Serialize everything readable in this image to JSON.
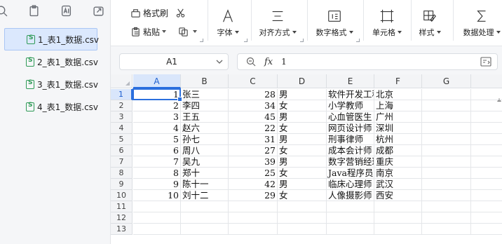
{
  "left_pane": {
    "files": [
      {
        "name": "1_表1_数据.csv",
        "selected": true
      },
      {
        "name": "2_表1_数据.csv",
        "selected": false
      },
      {
        "name": "3_表1_数据.csv",
        "selected": false
      },
      {
        "name": "4_表1_数据.csv",
        "selected": false
      }
    ]
  },
  "ribbon": {
    "format_painter": "格式刷",
    "paste": "粘贴",
    "font": "字体",
    "alignment": "对齐方式",
    "number_format": "数字格式",
    "cell": "单元格",
    "style": "样式",
    "data_processing": "数据处理"
  },
  "formula_bar": {
    "name_box": "A1",
    "fx": "fx",
    "value": "1"
  },
  "grid": {
    "columns": [
      "A",
      "B",
      "C",
      "D",
      "E",
      "F",
      "G"
    ],
    "active_column": "A",
    "active_row": 1,
    "row_numbers": [
      1,
      2,
      3,
      4,
      5,
      6,
      7,
      8,
      9,
      10,
      11,
      12,
      13
    ],
    "rows": [
      [
        "1",
        "张三",
        "28",
        "男",
        "软件开发工程师",
        "北京"
      ],
      [
        "2",
        "李四",
        "34",
        "女",
        "小学教师",
        "上海"
      ],
      [
        "3",
        "王五",
        "45",
        "男",
        "心血管医生",
        "广州"
      ],
      [
        "4",
        "赵六",
        "22",
        "女",
        "网页设计师",
        "深圳"
      ],
      [
        "5",
        "孙七",
        "31",
        "男",
        "刑事律师",
        "杭州"
      ],
      [
        "6",
        "周八",
        "27",
        "女",
        "成本会计师",
        "成都"
      ],
      [
        "7",
        "吴九",
        "39",
        "男",
        "数字营销经理",
        "重庆"
      ],
      [
        "8",
        "郑十",
        "25",
        "女",
        "Java程序员",
        "南京"
      ],
      [
        "9",
        "陈十一",
        "42",
        "男",
        "临床心理师",
        "武汉"
      ],
      [
        "10",
        "刘十二",
        "29",
        "女",
        "人像摄影师",
        "西安"
      ]
    ]
  },
  "colors": {
    "accent": "#2b6fde",
    "selected_file_bg": "#dbe8fd",
    "csv_icon": "#2f9a57"
  }
}
